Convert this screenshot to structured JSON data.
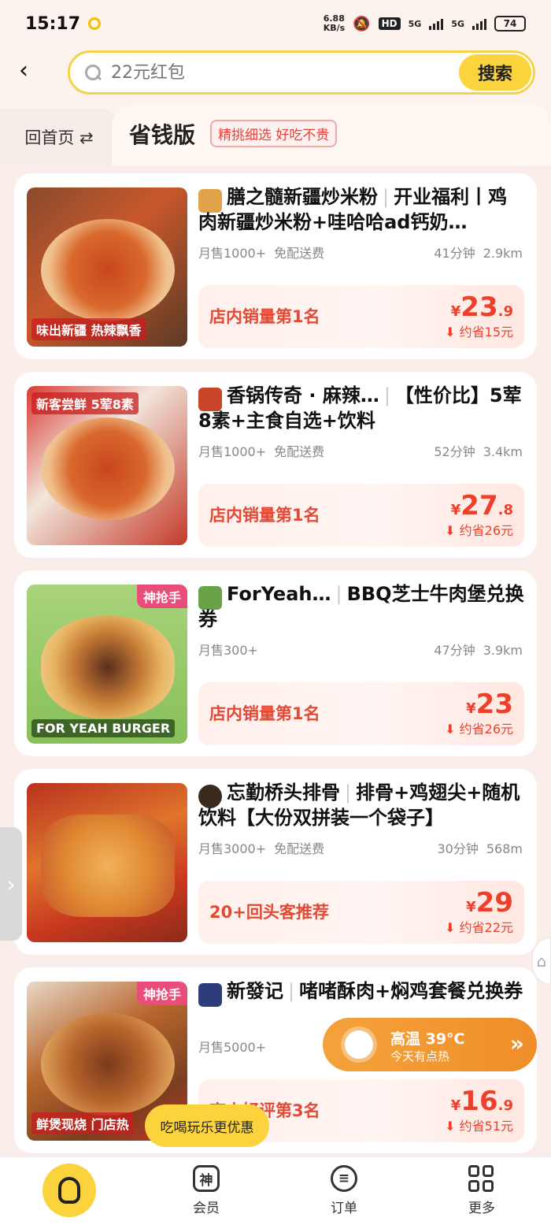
{
  "status_bar": {
    "time": "15:17",
    "net_speed": "6.88\nKB/s",
    "hd": "HD",
    "sim1": "5G",
    "sim2": "5G",
    "battery": "74"
  },
  "header": {
    "back_icon": "chevron-left-icon",
    "search_placeholder": "22元红包",
    "search_button": "搜索"
  },
  "tabs": {
    "home_label": "回首页 ⇄",
    "active_title": "省钱版",
    "active_tag": "精挑细选 好吃不贵"
  },
  "products": [
    {
      "shop": "膳之髓新疆炒米粉",
      "deal": "开业福利丨鸡肉新疆炒米粉+哇哈哈ad钙奶…",
      "monthly_sales": "月售1000+",
      "delivery": "免配送费",
      "time": "41分钟",
      "distance": "2.9km",
      "rank": "店内销量第1名",
      "price_int": "23",
      "price_dec": ".9",
      "currency": "¥",
      "save": "约省15元",
      "caption": "味出新疆 热辣飘香",
      "badge": "",
      "logo_color": "#7bbf4f"
    },
    {
      "shop": "香锅传奇 · 麻辣…",
      "deal": "【性价比】5荤8素+主食自选+饮料",
      "monthly_sales": "月售1000+",
      "delivery": "免配送费",
      "time": "52分钟",
      "distance": "3.4km",
      "rank": "店内销量第1名",
      "price_int": "27",
      "price_dec": ".8",
      "currency": "¥",
      "save": "约省26元",
      "caption": "新客尝鲜 5荤8素",
      "badge": "",
      "logo_color": "#c8452a"
    },
    {
      "shop": "ForYeah…",
      "deal": "BBQ芝士牛肉堡兑换券",
      "monthly_sales": "月售300+",
      "delivery": "",
      "time": "47分钟",
      "distance": "3.9km",
      "rank": "店内销量第1名",
      "price_int": "23",
      "price_dec": "",
      "currency": "¥",
      "save": "约省26元",
      "caption": "FOR YEAH BURGER",
      "badge": "神抢手",
      "logo_color": "#6aa24a"
    },
    {
      "shop": "忘勤桥头排骨",
      "deal": "排骨+鸡翅尖+随机饮料【大份双拼装一个袋子】",
      "monthly_sales": "月售3000+",
      "delivery": "免配送费",
      "time": "30分钟",
      "distance": "568m",
      "rank": "20+回头客推荐",
      "price_int": "29",
      "price_dec": "",
      "currency": "¥",
      "save": "约省22元",
      "caption": "",
      "badge": "",
      "logo_color": "#3a2a1c"
    },
    {
      "shop": "新發记",
      "deal": "啫啫酥肉+焖鸡套餐兑换券",
      "monthly_sales": "月售5000+",
      "delivery": "",
      "time": "",
      "distance": "",
      "rank": "高人好评第3名",
      "price_int": "16",
      "price_dec": ".9",
      "currency": "¥",
      "save": "约省51元",
      "caption": "鲜煲现烧 门店热",
      "badge": "神抢手",
      "logo_color": "#2c3d7a"
    }
  ],
  "weather": {
    "title": "高温 39°C",
    "subtitle": "今天有点热",
    "icon": "sun-icon"
  },
  "tooltip": "吃喝玩乐更优惠",
  "bottom_nav": {
    "home_icon": "bell-home-icon",
    "vip": "会员",
    "vip_icon_text": "神",
    "orders": "订单",
    "more": "更多"
  },
  "colors": {
    "accent": "#fbd33d",
    "price": "#ee3f2b",
    "weather": "#f5a23c"
  }
}
